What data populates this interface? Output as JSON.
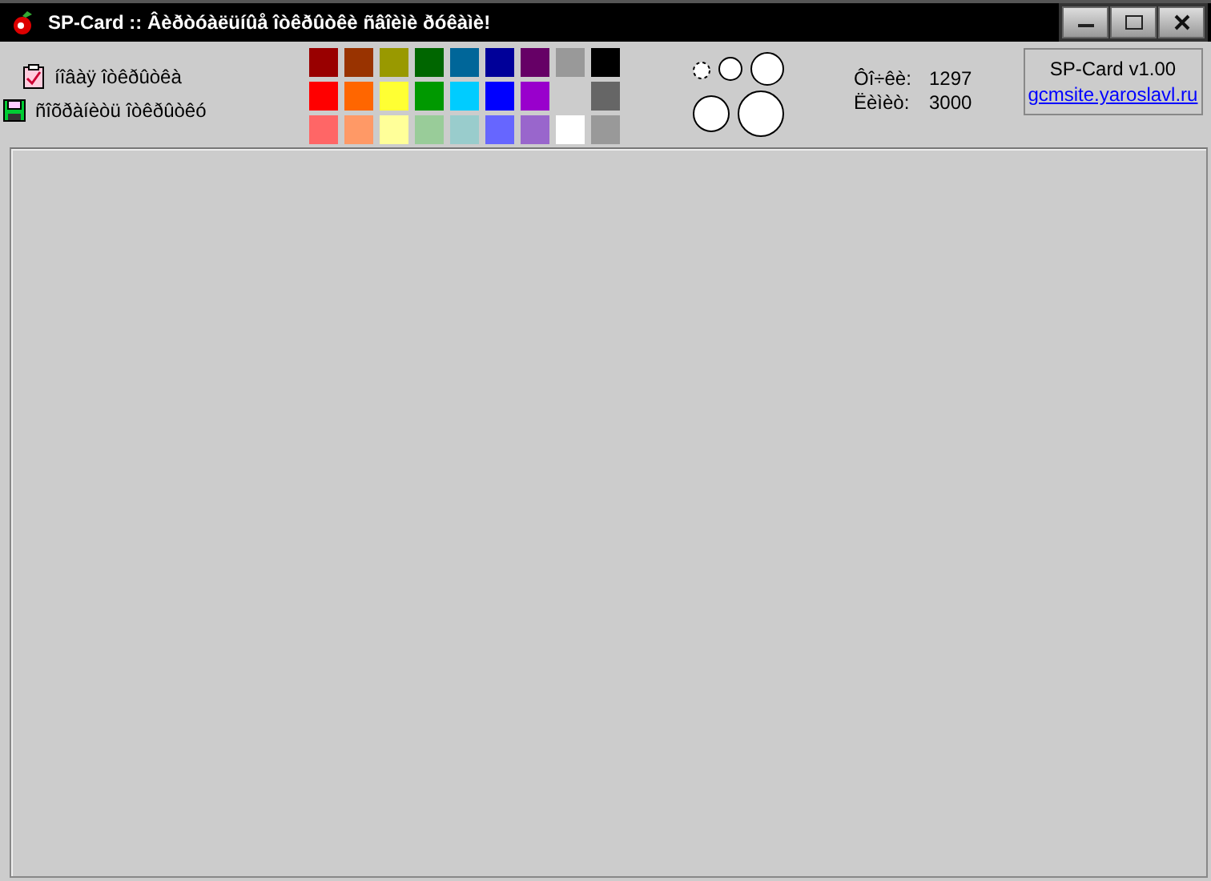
{
  "window": {
    "title": "SP-Card :: Âèðòóàëüíûå îòêðûòêè ñâîèìè ðóêàìè!"
  },
  "actions": [
    {
      "kind": "new",
      "label": "íîâàÿ îòêðûòêà"
    },
    {
      "kind": "save",
      "label": "ñîõðàíèòü îòêðûòêó"
    }
  ],
  "palette": [
    {
      "color": "#990000"
    },
    {
      "color": "#993300"
    },
    {
      "color": "#999900"
    },
    {
      "color": "#006600"
    },
    {
      "color": "#006699"
    },
    {
      "color": "#000099"
    },
    {
      "color": "#660066"
    },
    {
      "color": "#999999"
    },
    {
      "color": "#000000"
    },
    {
      "color": "#ff0000"
    },
    {
      "color": "#ff6600"
    },
    {
      "color": "#ffff33"
    },
    {
      "color": "#009900"
    },
    {
      "color": "#00ccff"
    },
    {
      "color": "#0000ff"
    },
    {
      "color": "#9900cc"
    },
    {
      "color": "#cccccc"
    },
    {
      "color": "#666666"
    },
    {
      "color": "#ff6666"
    },
    {
      "color": "#ff9966"
    },
    {
      "color": "#ffff99"
    },
    {
      "color": "#99cc99"
    },
    {
      "color": "#99cccc"
    },
    {
      "color": "#6666ff"
    },
    {
      "color": "#9966cc"
    },
    {
      "color": "#ffffff"
    },
    {
      "color": "#999999"
    }
  ],
  "brushes": [
    {
      "selected": true
    },
    {
      "selected": false
    },
    {
      "selected": false
    },
    {
      "selected": false
    },
    {
      "selected": false
    }
  ],
  "stats": [
    {
      "label": "Ôî÷êè:",
      "value": "1297"
    },
    {
      "label": "Ëèìèò:",
      "value": "3000"
    }
  ],
  "about": {
    "title": "SP-Card v1.00",
    "link": "gcmsite.yaroslavl.ru"
  }
}
